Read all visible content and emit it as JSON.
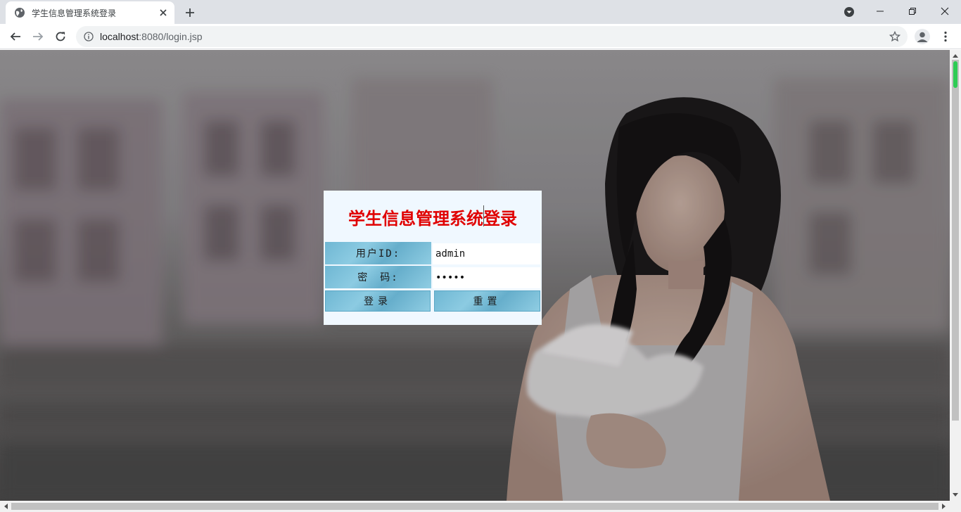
{
  "browser": {
    "tab_title": "学生信息管理系统登录",
    "new_tab_label": "+",
    "url_host": "localhost",
    "url_rest": ":8080/login.jsp"
  },
  "login": {
    "title": "学生信息管理系统登录",
    "user_label": "用户ID:",
    "user_value": "admin",
    "password_label": "密　码:",
    "password_mask": "•••••",
    "login_button": "登录",
    "reset_button": "重置"
  },
  "colors": {
    "title_red": "#e00000",
    "panel_bg": "#f0f8ff",
    "cell_blue": "#7fc2dc",
    "tabbar": "#dee1e6"
  },
  "icons": {
    "favicon": "globe-icon",
    "close": "close-icon",
    "back": "back-arrow-icon",
    "forward": "forward-arrow-icon",
    "reload": "reload-icon",
    "info": "info-icon",
    "star": "star-icon",
    "profile": "profile-icon",
    "menu": "kebab-menu-icon"
  }
}
